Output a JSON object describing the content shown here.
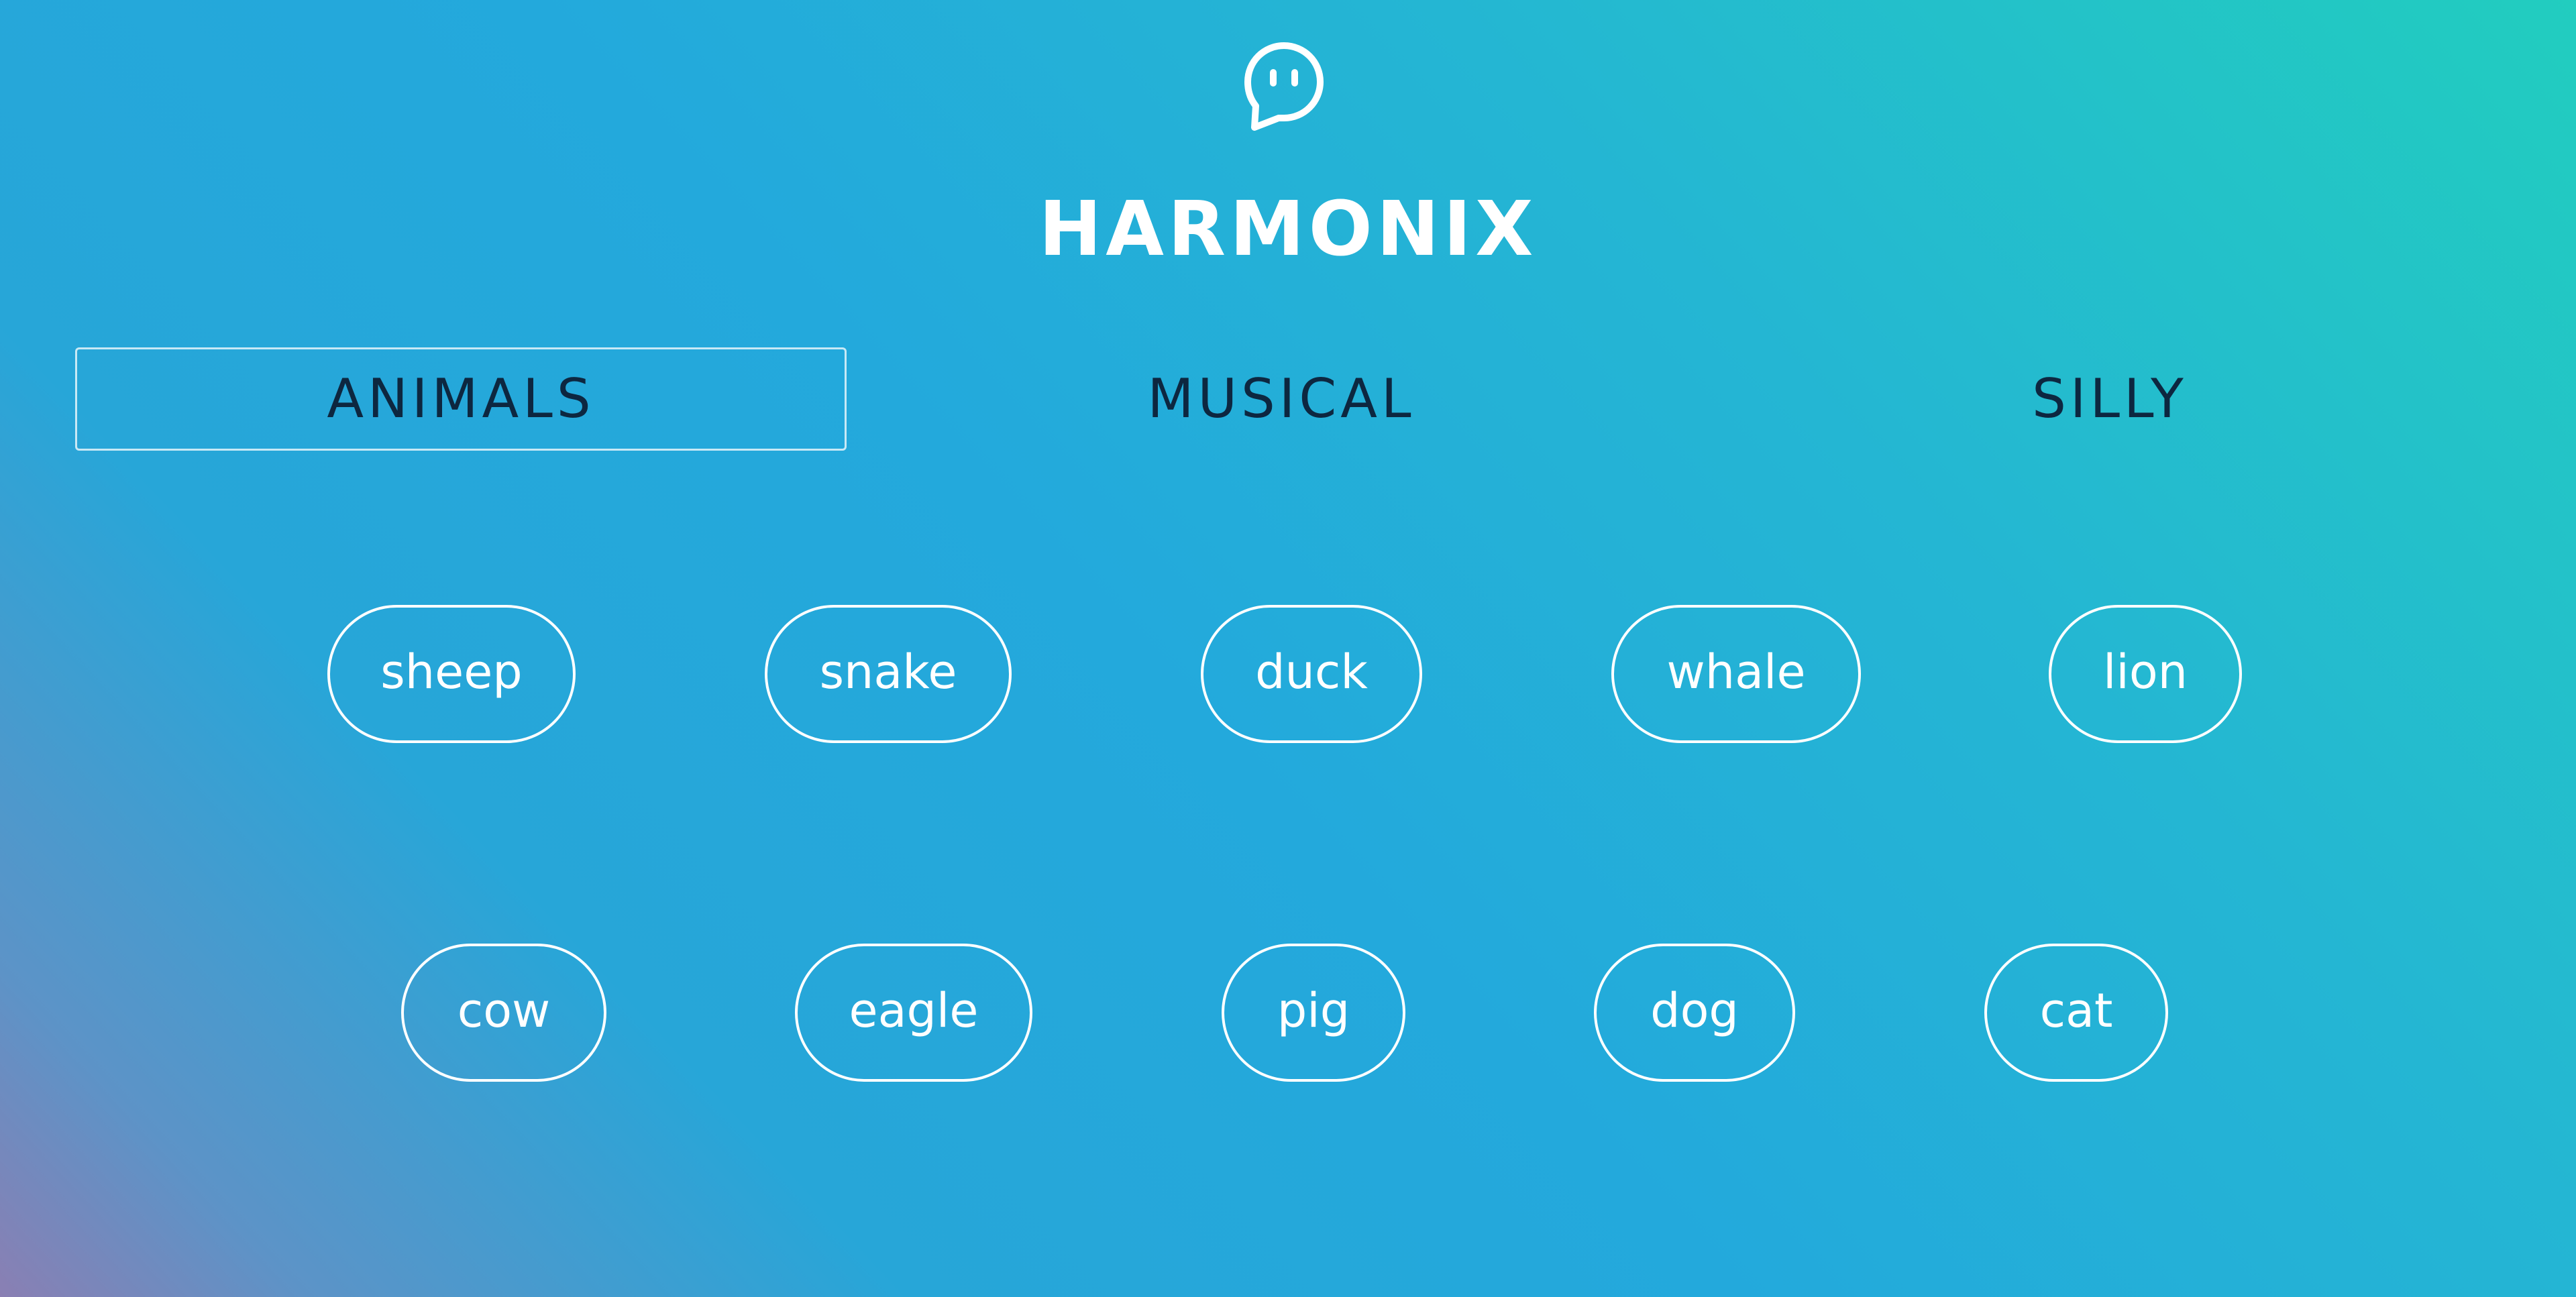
{
  "app": {
    "title": "HARMONIX",
    "logo_icon": "speech-bubble-face-icon"
  },
  "tabs": [
    {
      "label": "ANIMALS",
      "active": true
    },
    {
      "label": "MUSICAL",
      "active": false
    },
    {
      "label": "SILLY",
      "active": false
    }
  ],
  "sounds": {
    "row1": [
      "sheep",
      "snake",
      "duck",
      "whale",
      "lion"
    ],
    "row2": [
      "cow",
      "eagle",
      "pig",
      "dog",
      "cat"
    ]
  },
  "colors": {
    "text_light": "#ffffff",
    "tab_text": "#0d2740",
    "gradient_start": "#8a7fb3",
    "gradient_mid": "#23a9dc",
    "gradient_end": "#22cdbf"
  }
}
